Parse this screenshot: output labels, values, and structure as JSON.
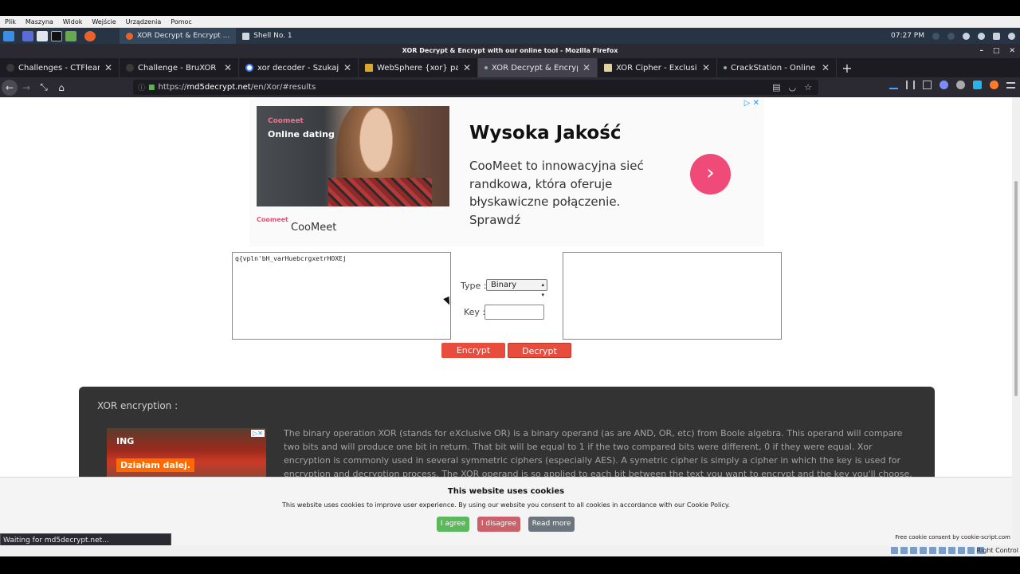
{
  "vbox_menu": [
    "Plik",
    "Maszyna",
    "Widok",
    "Wejście",
    "Urządzenia",
    "Pomoc"
  ],
  "taskbar": {
    "tasks": [
      {
        "label": "XOR Decrypt & Encrypt ...",
        "active": true
      },
      {
        "label": "Shell No. 1",
        "active": false
      }
    ],
    "clock": "07:27 PM"
  },
  "window_title": "XOR Decrypt & Encrypt with our online tool - Mozilla Firefox",
  "tabs": [
    {
      "label": "Challenges - CTFlearn -",
      "active": false
    },
    {
      "label": "Challenge - BruXOR - CT",
      "active": false
    },
    {
      "label": "xor decoder - Szukaj w G",
      "active": false
    },
    {
      "label": "WebSphere {xor} passw",
      "active": false
    },
    {
      "label": "XOR Decrypt & Encrypt w",
      "active": true
    },
    {
      "label": "XOR Cipher - Exclusive O",
      "active": false
    },
    {
      "label": "CrackStation - Online Pa",
      "active": false
    }
  ],
  "url": {
    "prefix": "https://",
    "host": "md5decrypt.net",
    "path": "/en/Xor/#results"
  },
  "ad_top": {
    "brand": "Coomeet",
    "photo_label": "Online dating",
    "headline": "Wysoka Jakość",
    "text": "CooMeet to innowacyjna sieć randkowa, która oferuje błyskawiczne połączenie. Sprawdź",
    "footer_logo": "Coomeet",
    "footer_name": "CooMeet",
    "cta_icon": "chevron-right-icon"
  },
  "tool": {
    "input_value": "q{vpln'bH_varHuebcrgxetrHOXEj",
    "output_value": "",
    "type_label": "Type :",
    "type_value": "Binary",
    "key_label": "Key :",
    "key_value": "",
    "encrypt_label": "Encrypt",
    "decrypt_label": "Decrypt"
  },
  "info": {
    "title": "XOR encryption :",
    "ad_brand": "ING",
    "ad_text": "Działam dalej.",
    "paragraph": "The binary operation XOR (stands for eXclusive OR) is a binary operand (as are AND, OR, etc) from Boole algebra. This operand will compare two bits and will produce one bit in return. That bit will be equal to 1 if the two compared bits were different, 0 if they were equal. Xor encryption is commonly used in several symmetric ciphers (especially AES). A symetric cipher is simply a cipher in which the key is used for encryption and decryption process. The XOR operand is so applied to each bit between the text you want to encrypt and the key you'll choose. Examples are better than words, let's take the word \"xor\". We want to"
  },
  "cookie": {
    "title": "This website uses cookies",
    "text": "This website uses cookies to improve user experience. By using our website you consent to all cookies in accordance with our Cookie Policy.",
    "agree": "I agree",
    "disagree": "I disagree",
    "read_more": "Read more",
    "credit": "Free cookie consent by cookie-script.com"
  },
  "status_text": "Waiting for md5decrypt.net...",
  "vbox_status": "Right Control",
  "colors": {
    "accent_red": "#e74c3c",
    "coomeet_pink": "#f04a78",
    "agree_green": "#5cb85c",
    "disagree_red": "#c9606a",
    "readmore_gray": "#6c757d"
  }
}
